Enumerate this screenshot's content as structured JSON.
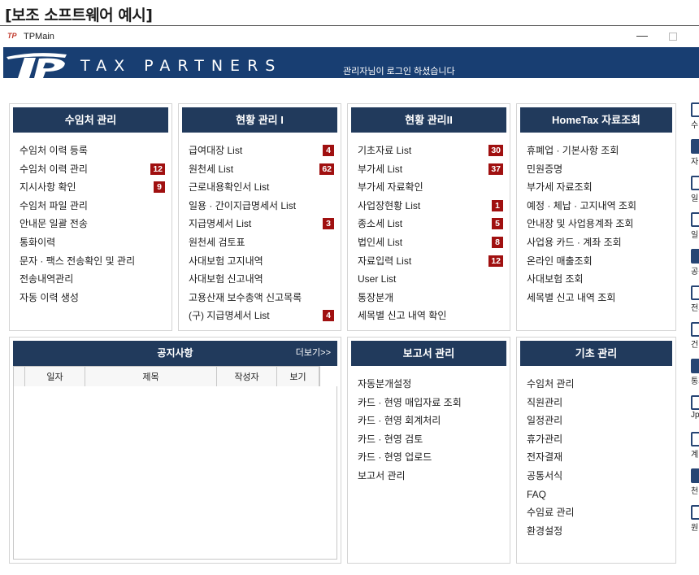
{
  "caption": "[보조 소프트웨어 예시]",
  "window": {
    "icon_text": "TP",
    "title": "TPMain",
    "minimize": "—"
  },
  "banner": {
    "brand": "TAX PARTNERS",
    "login_message": "관리자님이 로그인 하셨습니다",
    "color": "#183e72"
  },
  "panels": [
    {
      "title": "수임처 관리",
      "items": [
        {
          "label": "수임처 이력 등록",
          "badge": ""
        },
        {
          "label": "수임처 이력 관리",
          "badge": "12"
        },
        {
          "label": "지시사항 확인",
          "badge": "9"
        },
        {
          "label": "수임처 파일 관리",
          "badge": ""
        },
        {
          "label": "안내문 일괄 전송",
          "badge": ""
        },
        {
          "label": "통화이력",
          "badge": ""
        },
        {
          "label": "문자 · 팩스 전송확인 및 관리",
          "badge": ""
        },
        {
          "label": "전송내역관리",
          "badge": ""
        },
        {
          "label": "자동 이력 생성",
          "badge": ""
        }
      ]
    },
    {
      "title": "현황 관리 I",
      "items": [
        {
          "label": "급여대장 List",
          "badge": "4"
        },
        {
          "label": "원천세 List",
          "badge": "62"
        },
        {
          "label": "근로내용확인서 List",
          "badge": ""
        },
        {
          "label": "일용 · 간이지급명세서 List",
          "badge": ""
        },
        {
          "label": "지급명세서 List",
          "badge": "3"
        },
        {
          "label": "원천세 검토표",
          "badge": ""
        },
        {
          "label": "사대보험 고지내역",
          "badge": ""
        },
        {
          "label": "사대보험 신고내역",
          "badge": ""
        },
        {
          "label": "고용산재 보수총액 신고목록",
          "badge": ""
        },
        {
          "label": "(구) 지급명세서 List",
          "badge": "4"
        }
      ]
    },
    {
      "title": "현황 관리II",
      "items": [
        {
          "label": "기초자료 List",
          "badge": "30"
        },
        {
          "label": "부가세 List",
          "badge": "37"
        },
        {
          "label": "부가세 자료확인",
          "badge": ""
        },
        {
          "label": "사업장현황 List",
          "badge": "1"
        },
        {
          "label": "종소세 List",
          "badge": "5"
        },
        {
          "label": "법인세 List",
          "badge": "8"
        },
        {
          "label": "자료입력 List",
          "badge": "12"
        },
        {
          "label": "User List",
          "badge": ""
        },
        {
          "label": "통장분개",
          "badge": ""
        },
        {
          "label": "세목별 신고 내역 확인",
          "badge": ""
        }
      ]
    },
    {
      "title": "HomeTax 자료조회",
      "items": [
        {
          "label": "휴폐업 · 기본사항 조회",
          "badge": ""
        },
        {
          "label": "민원증명",
          "badge": ""
        },
        {
          "label": "부가세 자료조회",
          "badge": ""
        },
        {
          "label": "예정 · 체납 · 고지내역 조회",
          "badge": ""
        },
        {
          "label": "안내장 및 사업용계좌 조회",
          "badge": ""
        },
        {
          "label": "사업용 카드 · 계좌 조회",
          "badge": ""
        },
        {
          "label": "온라인 매출조회",
          "badge": ""
        },
        {
          "label": "사대보험 조회",
          "badge": ""
        },
        {
          "label": "세목별 신고 내역 조회",
          "badge": ""
        }
      ]
    },
    {
      "title": "보고서 관리",
      "items": [
        {
          "label": "자동분개설정",
          "badge": ""
        },
        {
          "label": "카드 · 현영 매입자료 조회",
          "badge": ""
        },
        {
          "label": "카드 · 현영 회계처리",
          "badge": ""
        },
        {
          "label": "카드 · 현영 검토",
          "badge": ""
        },
        {
          "label": "카드 · 현영 업로드",
          "badge": ""
        },
        {
          "label": "보고서 관리",
          "badge": ""
        }
      ]
    },
    {
      "title": "기초 관리",
      "items": [
        {
          "label": "수임처 관리",
          "badge": ""
        },
        {
          "label": "직원관리",
          "badge": ""
        },
        {
          "label": "일정관리",
          "badge": ""
        },
        {
          "label": "휴가관리",
          "badge": ""
        },
        {
          "label": "전자결재",
          "badge": ""
        },
        {
          "label": "공통서식",
          "badge": ""
        },
        {
          "label": "FAQ",
          "badge": ""
        },
        {
          "label": "수임료 관리",
          "badge": ""
        },
        {
          "label": "환경설정",
          "badge": ""
        }
      ]
    }
  ],
  "notice": {
    "title": "공지사항",
    "more": "더보기>>",
    "columns": [
      "",
      "일자",
      "제목",
      "작성자",
      "보기",
      ""
    ]
  },
  "sidebar": [
    {
      "icon": "document-icon",
      "label": "수"
    },
    {
      "icon": "chart-icon",
      "label": "자"
    },
    {
      "icon": "calendar-icon",
      "label": "일"
    },
    {
      "icon": "calendar-icon",
      "label": "일"
    },
    {
      "icon": "form-icon",
      "label": "공통"
    },
    {
      "icon": "pen-icon",
      "label": "전자"
    },
    {
      "icon": "person-icon",
      "label": "건"
    },
    {
      "icon": "bars-icon",
      "label": "통화"
    },
    {
      "icon": "image-icon",
      "label": "Jpg"
    },
    {
      "icon": "calculator-icon",
      "label": "계"
    },
    {
      "icon": "building-icon",
      "label": "천"
    },
    {
      "icon": "monitor-icon",
      "label": "원"
    }
  ],
  "colors": {
    "header": "#213a5c",
    "badge": "#a01010"
  }
}
